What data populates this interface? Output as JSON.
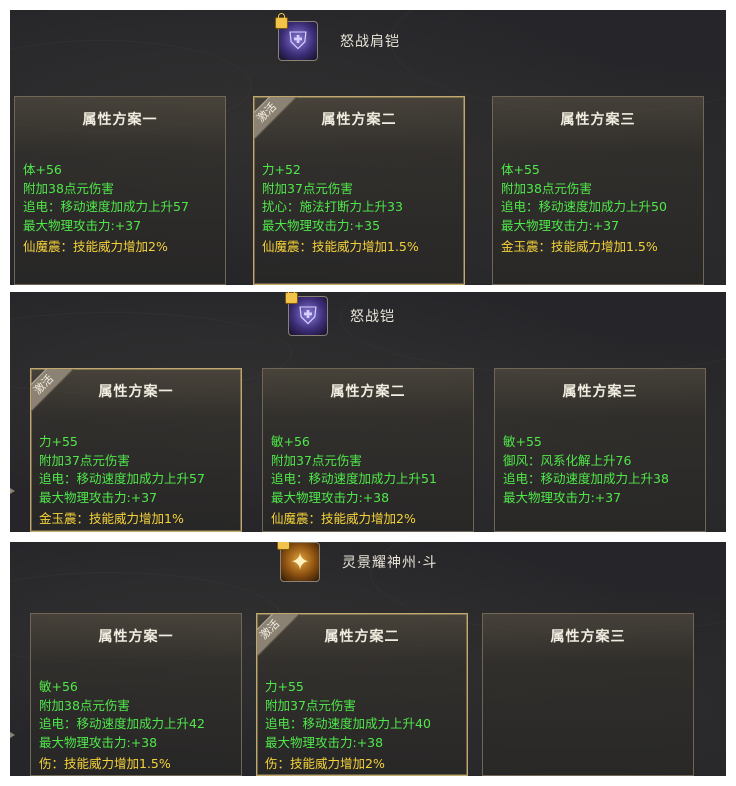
{
  "items": [
    {
      "name": "怒战肩铠",
      "icon": "shoulder-armor-icon",
      "active_label": "激活",
      "plans": [
        {
          "title": "属性方案一",
          "active": false,
          "stats": [
            "体+56",
            "附加38点元伤害",
            "追电：移动速度加成力上升57",
            "最大物理攻击力:+37"
          ],
          "skill": "仙魔震：技能威力增加2%"
        },
        {
          "title": "属性方案二",
          "active": true,
          "stats": [
            "力+52",
            "附加37点元伤害",
            "扰心：施法打断力上升33",
            "最大物理攻击力:+35"
          ],
          "skill": "仙魔震：技能威力增加1.5%"
        },
        {
          "title": "属性方案三",
          "active": false,
          "stats": [
            "体+55",
            "附加38点元伤害",
            "追电：移动速度加成力上升50",
            "最大物理攻击力:+37"
          ],
          "skill": "金玉震：技能威力增加1.5%"
        }
      ]
    },
    {
      "name": "怒战铠",
      "icon": "chest-armor-icon",
      "active_label": "激活",
      "plans": [
        {
          "title": "属性方案一",
          "active": true,
          "stats": [
            "力+55",
            "附加37点元伤害",
            "追电：移动速度加成力上升57",
            "最大物理攻击力:+37"
          ],
          "skill": "金玉震：技能威力增加1%"
        },
        {
          "title": "属性方案二",
          "active": false,
          "stats": [
            "敏+56",
            "附加37点元伤害",
            "追电：移动速度加成力上升51",
            "最大物理攻击力:+38"
          ],
          "skill": "仙魔震：技能威力增加2%"
        },
        {
          "title": "属性方案三",
          "active": false,
          "stats": [
            "敏+55",
            "御风：风系化解上升76",
            "追电：移动速度加成力上升38",
            "最大物理攻击力:+37"
          ],
          "skill": ""
        }
      ]
    },
    {
      "name": "灵景耀神州·斗",
      "icon": "bracer-icon",
      "active_label": "激活",
      "plans": [
        {
          "title": "属性方案一",
          "active": false,
          "stats": [
            "敏+56",
            "附加38点元伤害",
            "追电：移动速度加成力上升42",
            "最大物理攻击力:+38"
          ],
          "skill": "伤：技能威力增加1.5%"
        },
        {
          "title": "属性方案二",
          "active": true,
          "stats": [
            "力+55",
            "附加37点元伤害",
            "追电：移动速度加成力上升40",
            "最大物理攻击力:+38"
          ],
          "skill": "伤：技能威力增加2%"
        },
        {
          "title": "属性方案三",
          "active": false,
          "stats": [],
          "skill": ""
        }
      ]
    }
  ]
}
